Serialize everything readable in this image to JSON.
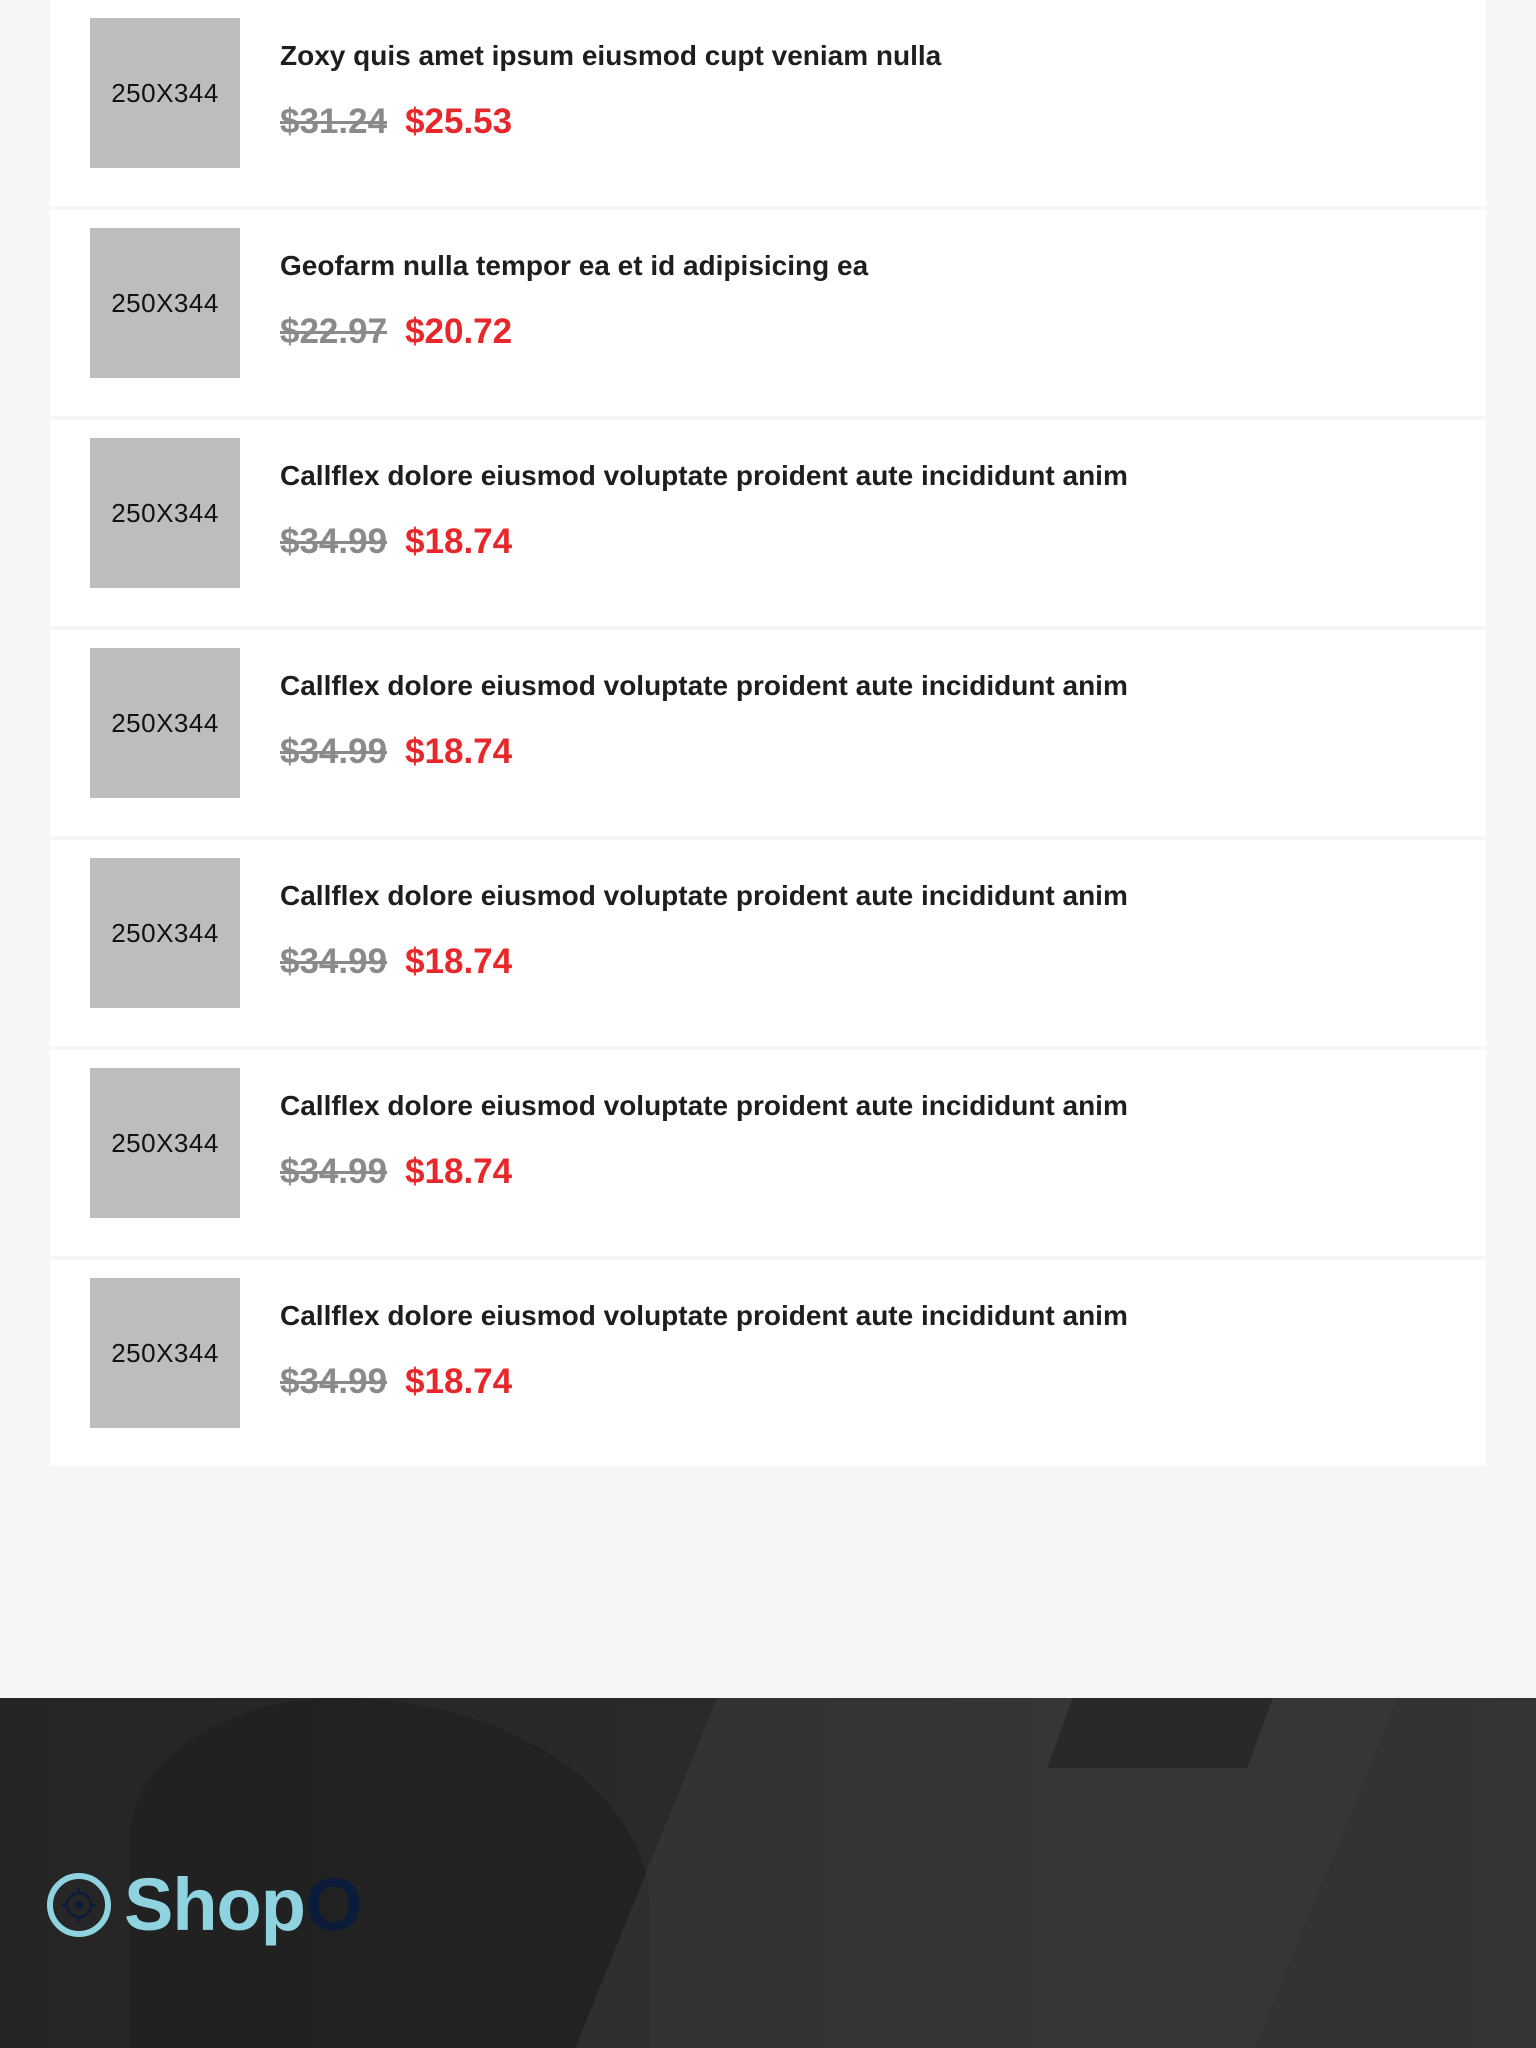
{
  "products": [
    {
      "thumb": "250X344",
      "title": "Zoxy quis amet ipsum eiusmod cupt veniam nulla",
      "old_price": "$31.24",
      "new_price": "$25.53"
    },
    {
      "thumb": "250X344",
      "title": "Geofarm nulla tempor ea et id adipisicing ea",
      "old_price": "$22.97",
      "new_price": "$20.72"
    },
    {
      "thumb": "250X344",
      "title": "Callflex dolore eiusmod voluptate proident aute incididunt anim",
      "old_price": "$34.99",
      "new_price": "$18.74"
    },
    {
      "thumb": "250X344",
      "title": "Callflex dolore eiusmod voluptate proident aute incididunt anim",
      "old_price": "$34.99",
      "new_price": "$18.74"
    },
    {
      "thumb": "250X344",
      "title": "Callflex dolore eiusmod voluptate proident aute incididunt anim",
      "old_price": "$34.99",
      "new_price": "$18.74"
    },
    {
      "thumb": "250X344",
      "title": "Callflex dolore eiusmod voluptate proident aute incididunt anim",
      "old_price": "$34.99",
      "new_price": "$18.74"
    },
    {
      "thumb": "250X344",
      "title": "Callflex dolore eiusmod voluptate proident aute incididunt anim",
      "old_price": "$34.99",
      "new_price": "$18.74"
    }
  ],
  "footer": {
    "logo_main": "Shop",
    "logo_accent": "O",
    "logo_icon": "target-icon"
  },
  "colors": {
    "page_background": "#f6f6f6",
    "card_background": "#ffffff",
    "placeholder_gray": "#bdbdbd",
    "old_price": "#8a8a8a",
    "sale_price": "#e8272a",
    "logo_primary": "#8fd3e1",
    "logo_accent": "#0b1c3a",
    "footer_dark": "#252525"
  }
}
